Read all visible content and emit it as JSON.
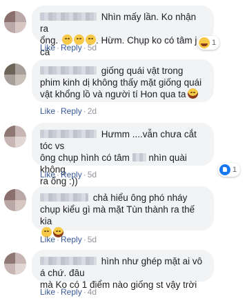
{
  "comments": [
    {
      "lines": [
        "Nhìn mấy lần. Ko nhận ra",
        "ổng. ",
        ". Hừm. Chụp ko có tâm j cả"
      ],
      "emoji_count_line2": 3,
      "reaction": {
        "type": "haha",
        "count": "1"
      },
      "like_label": "Like",
      "reply_label": "Reply",
      "time": "5d"
    },
    {
      "lines": [
        "giống quái vật trong",
        "phim kinh dị không thấy mặt giống quái",
        "vật khổng lồ và người tí Hon qua ta"
      ],
      "reaction": null,
      "like_label": "Like",
      "reply_label": "Reply",
      "time": "2d"
    },
    {
      "lines": [
        "Hưmm ....vẫn chưa cắt tóc vs",
        "ông chụp hình có tâm",
        "nhìn quài không",
        "ra ổng :))"
      ],
      "reaction": {
        "type": "like",
        "count": "1"
      },
      "like_label": "Like",
      "reply_label": "Reply",
      "time": "5d"
    },
    {
      "lines": [
        "chả hiểu ông phó nháy",
        "chụp kiểu gì mà mặt Tùn thành ra thế kia"
      ],
      "reaction": null,
      "like_label": "Like",
      "reply_label": "Reply",
      "time": "5d"
    },
    {
      "lines": [
        "hình như ghép mặt ai vô á chứ. đâu",
        "mà Ko có 1 điểm nào giống st vậy trời"
      ],
      "reaction": null,
      "like_label": "Like",
      "reply_label": "Reply",
      "time": "4d"
    }
  ],
  "colors": {
    "bubble": "#f2f3f5",
    "link": "#385898",
    "meta": "#90949c",
    "like_blue": "#1877f2"
  },
  "icons": {
    "emoji": "grinning-face-icon",
    "laugh": "haha-reaction-icon",
    "like": "like-reaction-icon"
  }
}
